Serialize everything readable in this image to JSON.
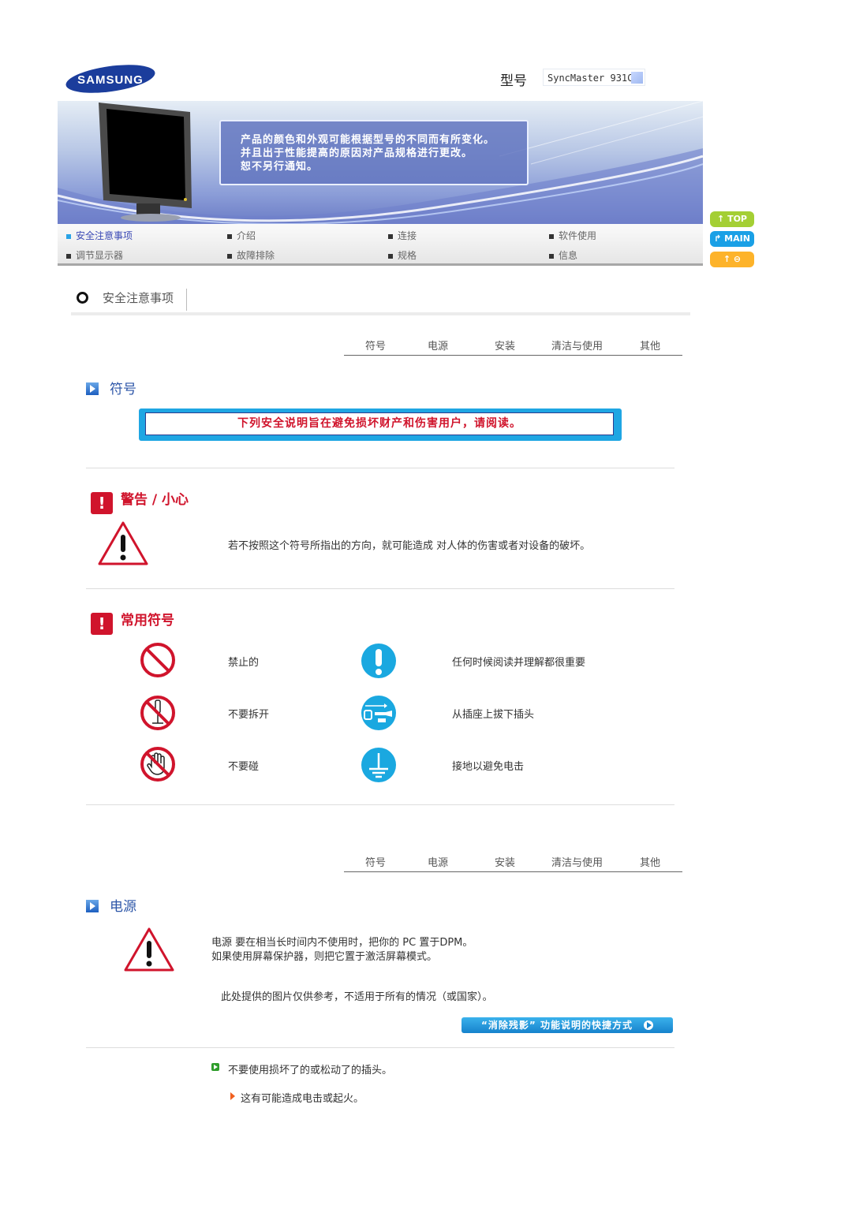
{
  "header": {
    "brand": "SAMSUNG",
    "model_label": "型号",
    "model_value": "SyncMaster 931C"
  },
  "banner": {
    "notice_lines": [
      "产品的颜色和外观可能根据型号的不同而有所变化。",
      "并且出于性能提高的原因对产品规格进行更改。",
      "恕不另行通知。"
    ]
  },
  "nav": {
    "items": [
      {
        "label": "安全注意事项",
        "active": true
      },
      {
        "label": "介绍",
        "active": false
      },
      {
        "label": "连接",
        "active": false
      },
      {
        "label": "软件使用",
        "active": false
      },
      {
        "label": "调节显示器",
        "active": false
      },
      {
        "label": "故障排除",
        "active": false
      },
      {
        "label": "规格",
        "active": false
      },
      {
        "label": "信息",
        "active": false
      }
    ],
    "side_buttons": {
      "top": "TOP",
      "main": "MAIN",
      "back": "↑"
    }
  },
  "page": {
    "title": "安全注意事项"
  },
  "tabs": [
    "符号",
    "电源",
    "安装",
    "清洁与使用",
    "其他"
  ],
  "symbols_section": {
    "heading": "符号",
    "notice": "下列安全说明旨在避免损坏财产和伤害用户，请阅读。",
    "warning": {
      "heading": "警告 / 小心",
      "text": "若不按照这个符号所指出的方向，就可能造成 对人体的伤害或者对设备的破坏。"
    },
    "common": {
      "heading": "常用符号",
      "items": [
        {
          "icon": "prohibited-icon",
          "label": "禁止的"
        },
        {
          "icon": "important-icon",
          "label": "任何时候阅读并理解都很重要"
        },
        {
          "icon": "no-disassemble-icon",
          "label": "不要拆开"
        },
        {
          "icon": "unplug-icon",
          "label": "从插座上拔下插头"
        },
        {
          "icon": "no-touch-icon",
          "label": "不要碰"
        },
        {
          "icon": "ground-icon",
          "label": "接地以避免电击"
        }
      ]
    }
  },
  "power_section": {
    "heading": "电源",
    "lines": [
      "电源 要在相当长时间内不使用时，把你的 PC 置于DPM。",
      "如果使用屏幕保护器，则把它置于激活屏幕模式。"
    ],
    "disclaimer": "此处提供的图片仅供参考，不适用于所有的情况（或国家）。",
    "link_button": "“消除残影” 功能说明的快捷方式",
    "bullet": "不要使用损坏了的或松动了的插头。",
    "sub_bullet": "这有可能造成电击或起火。"
  },
  "colors": {
    "accent_red": "#d0142c",
    "accent_blue": "#1fa6e3",
    "heading_blue": "#2d56a8",
    "nav_active": "#3a49b5"
  }
}
